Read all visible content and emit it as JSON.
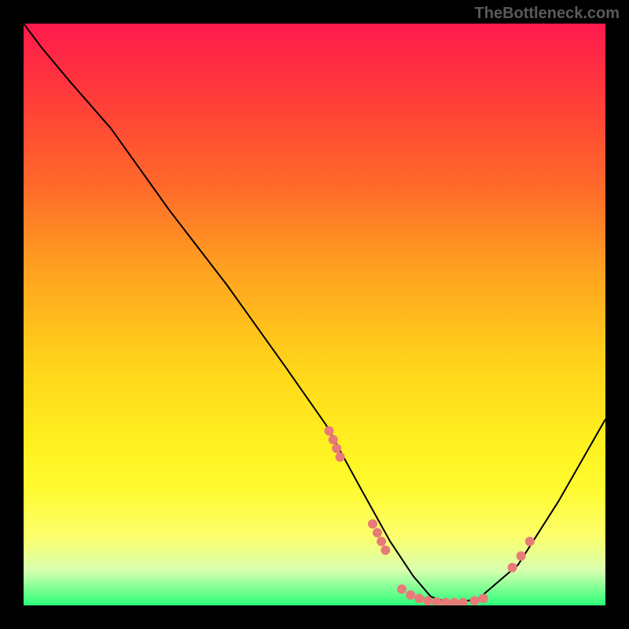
{
  "watermark": "TheBottleneck.com",
  "chart_data": {
    "type": "line",
    "title": "",
    "xlabel": "",
    "ylabel": "",
    "xlim": [
      0,
      100
    ],
    "ylim": [
      0,
      100
    ],
    "grid": false,
    "legend": false,
    "series": [
      {
        "name": "bottleneck-curve",
        "x": [
          0,
          3,
          8,
          15,
          25,
          35,
          45,
          52,
          58,
          63,
          67,
          70,
          73,
          78,
          85,
          92,
          100
        ],
        "y": [
          100,
          96,
          90,
          82,
          68,
          55,
          41,
          31,
          20,
          11,
          5,
          1.5,
          0.5,
          1,
          7,
          18,
          32
        ],
        "stroke": "#000000",
        "stroke_width": 2
      }
    ],
    "scatter": [
      {
        "name": "marker-cluster-left",
        "x": [
          52.5,
          53.2,
          53.8,
          54.4
        ],
        "y": [
          30,
          28.5,
          27,
          25.5
        ],
        "color": "#e87b78",
        "size": 6
      },
      {
        "name": "marker-cluster-mid",
        "x": [
          60,
          60.8,
          61.5,
          62.2
        ],
        "y": [
          14,
          12.5,
          11,
          9.5
        ],
        "color": "#e87b78",
        "size": 6
      },
      {
        "name": "marker-cluster-bottom",
        "x": [
          65,
          66.5,
          68,
          69.5,
          71,
          72.5,
          74,
          75.5,
          77.5,
          79
        ],
        "y": [
          2.8,
          1.8,
          1.2,
          0.8,
          0.6,
          0.5,
          0.5,
          0.5,
          0.8,
          1.2
        ],
        "color": "#e87b78",
        "size": 6
      },
      {
        "name": "marker-cluster-right",
        "x": [
          84,
          85.5,
          87
        ],
        "y": [
          6.5,
          8.5,
          11
        ],
        "color": "#e87b78",
        "size": 6
      }
    ]
  }
}
